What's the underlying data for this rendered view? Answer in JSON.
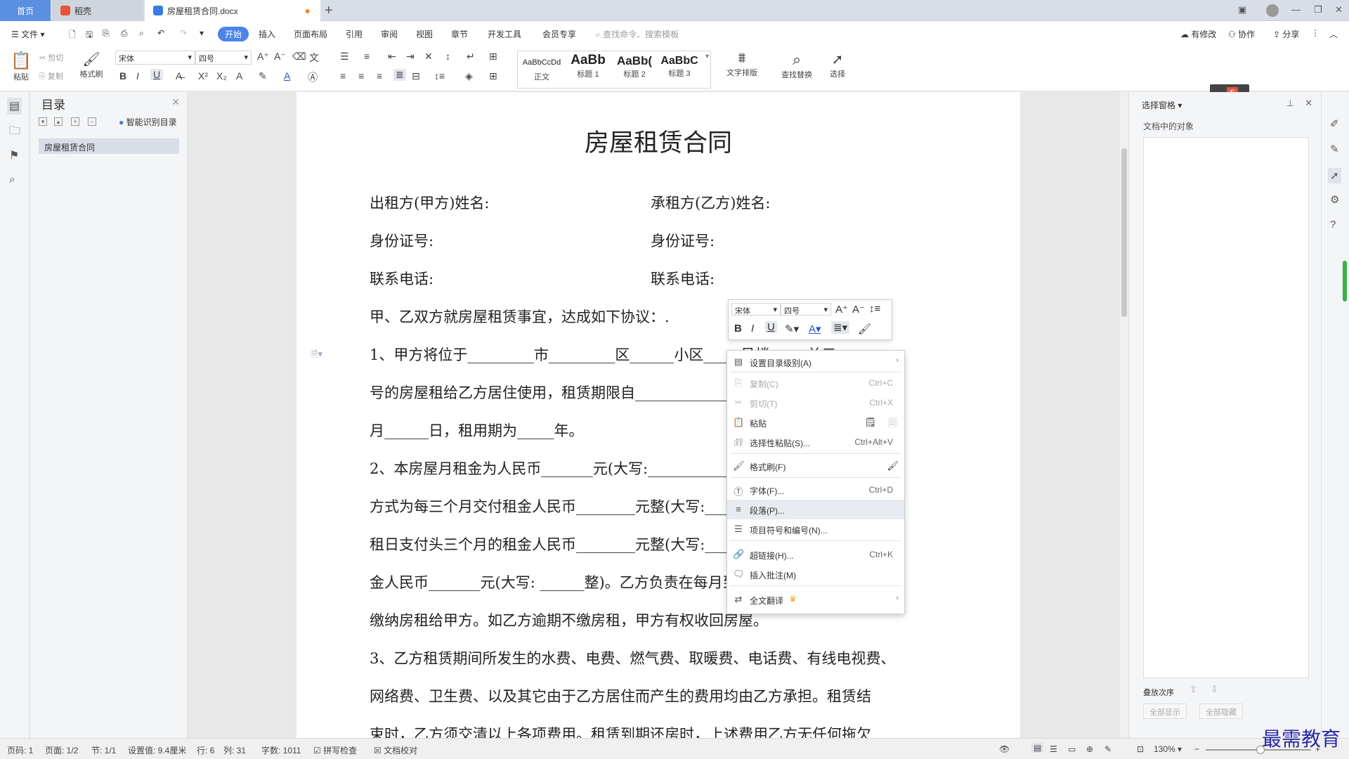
{
  "tabs": [
    {
      "label": "首页"
    },
    {
      "label": "稻壳"
    },
    {
      "label": "房屋租赁合同.docx"
    }
  ],
  "menu": {
    "file": "文件",
    "items": [
      "开始",
      "插入",
      "页面布局",
      "引用",
      "审阅",
      "视图",
      "章节",
      "开发工具",
      "会员专享"
    ],
    "search_placeholder": "查找命令、搜索模板",
    "right": [
      "有修改",
      "协作",
      "分享"
    ]
  },
  "ribbon": {
    "paste": "粘贴",
    "cut": "剪切",
    "copy": "复制",
    "format_painter": "格式刷",
    "font": "宋体",
    "size": "四号",
    "styles": [
      {
        "preview": "AaBbCcDd",
        "label": "正文"
      },
      {
        "preview": "AaBb",
        "label": "标题 1"
      },
      {
        "preview": "AaBb(",
        "label": "标题 2"
      },
      {
        "preview": "AaBbC",
        "label": "标题 3"
      }
    ],
    "text_layout": "文字排版",
    "find_replace": "查找替换",
    "select": "选择"
  },
  "toc": {
    "title": "目录",
    "smart": "智能识别目录",
    "items": [
      "房屋租赁合同"
    ]
  },
  "document": {
    "title": "房屋租赁合同",
    "lines": [
      "出租方(甲方)姓名:",
      "承租方(乙方)姓名:",
      "身份证号:",
      "身份证号:",
      "联系电话:",
      "联系电话:",
      "甲、乙双方就房屋租赁事宜，达成如下协议：.",
      "1、甲方将位于_________市_________区______小区_____号楼_____单元",
      "号的房屋租给乙方居住使用，租赁期限自________________________年",
      "月______日，租用期为_____年。",
      "2、本房屋月租金为人民币_______元(大写:___________)，租金缴纳",
      "方式为每三个月交付租金人民币________元整(大写:______)，乙方于承",
      "租日支付头三个月的租金人民币________元整(大写:______)，支付押",
      "金人民币_______元(大写: ______整)。乙方负责在每月到期前10 天",
      "缴纳房租给甲方。如乙方逾期不缴房租，甲方有权收回房屋。",
      "3、乙方租赁期间所发生的水费、电费、燃气费、取暖费、电话费、有线电视费、",
      "网络费、卫生费、以及其它由于乙方居住而产生的费用均由乙方承担。租赁结",
      "束时，乙方须交清以上各项费用。租赁到期还房时，上述费用乙方无任何拖欠"
    ]
  },
  "minibar": {
    "font": "宋体",
    "size": "四号"
  },
  "context_menu": [
    {
      "label": "设置目录级别(A)",
      "shortcut": "",
      "disabled": false,
      "arrow": true,
      "icon": "toc-level-icon"
    },
    {
      "label": "复制(C)",
      "shortcut": "Ctrl+C",
      "disabled": true,
      "arrow": false,
      "icon": "copy-icon"
    },
    {
      "label": "剪切(T)",
      "shortcut": "Ctrl+X",
      "disabled": true,
      "arrow": false,
      "icon": "cut-icon"
    },
    {
      "label": "粘贴",
      "shortcut": "",
      "disabled": false,
      "arrow": false,
      "icon": "paste-icon"
    },
    {
      "label": "选择性粘贴(S)...",
      "shortcut": "Ctrl+Alt+V",
      "disabled": false,
      "arrow": false,
      "icon": "paste-special-icon"
    },
    {
      "label": "格式刷(F)",
      "shortcut": "",
      "disabled": false,
      "arrow": false,
      "icon": "format-painter-icon"
    },
    {
      "label": "字体(F)...",
      "shortcut": "Ctrl+D",
      "disabled": false,
      "arrow": false,
      "icon": "font-icon"
    },
    {
      "label": "段落(P)...",
      "shortcut": "",
      "disabled": false,
      "arrow": false,
      "icon": "paragraph-icon",
      "highlight": true
    },
    {
      "label": "项目符号和编号(N)...",
      "shortcut": "",
      "disabled": false,
      "arrow": false,
      "icon": "list-icon"
    },
    {
      "label": "超链接(H)...",
      "shortcut": "Ctrl+K",
      "disabled": false,
      "arrow": false,
      "icon": "link-icon"
    },
    {
      "label": "插入批注(M)",
      "shortcut": "",
      "disabled": false,
      "arrow": false,
      "icon": "comment-icon"
    },
    {
      "label": "全文翻译",
      "shortcut": "",
      "disabled": false,
      "arrow": true,
      "icon": "translate-icon"
    }
  ],
  "right_panel": {
    "title": "选择窗格",
    "subtitle": "文档中的对象",
    "order": "叠放次序",
    "show_all": "全部显示",
    "hide_all": "全部隐藏"
  },
  "statusbar": {
    "page_no": "页码: 1",
    "pages": "页面: 1/2",
    "section": "节: 1/1",
    "setting": "设置值: 9.4厘米",
    "row": "行: 6",
    "col": "列: 31",
    "words": "字数: 1011",
    "spell": "拼写检查",
    "proof": "文档校对",
    "zoom": "130%"
  },
  "watermark": "最需教育",
  "colors": {
    "accent": "#4b83ea",
    "home_tab": "#5b8fe0",
    "watermark": "#2a2aa8"
  }
}
